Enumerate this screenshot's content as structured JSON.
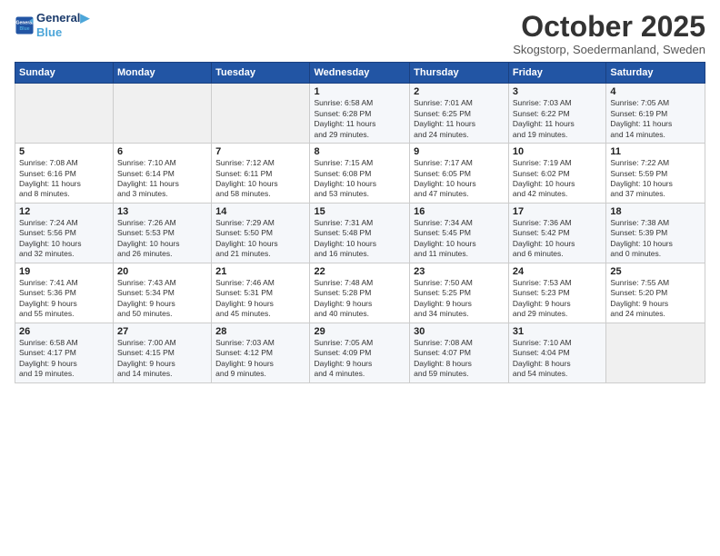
{
  "header": {
    "logo_line1": "General",
    "logo_line2": "Blue",
    "month": "October 2025",
    "location": "Skogstorp, Soedermanland, Sweden"
  },
  "weekdays": [
    "Sunday",
    "Monday",
    "Tuesday",
    "Wednesday",
    "Thursday",
    "Friday",
    "Saturday"
  ],
  "weeks": [
    [
      {
        "day": "",
        "info": ""
      },
      {
        "day": "",
        "info": ""
      },
      {
        "day": "",
        "info": ""
      },
      {
        "day": "1",
        "info": "Sunrise: 6:58 AM\nSunset: 6:28 PM\nDaylight: 11 hours\nand 29 minutes."
      },
      {
        "day": "2",
        "info": "Sunrise: 7:01 AM\nSunset: 6:25 PM\nDaylight: 11 hours\nand 24 minutes."
      },
      {
        "day": "3",
        "info": "Sunrise: 7:03 AM\nSunset: 6:22 PM\nDaylight: 11 hours\nand 19 minutes."
      },
      {
        "day": "4",
        "info": "Sunrise: 7:05 AM\nSunset: 6:19 PM\nDaylight: 11 hours\nand 14 minutes."
      }
    ],
    [
      {
        "day": "5",
        "info": "Sunrise: 7:08 AM\nSunset: 6:16 PM\nDaylight: 11 hours\nand 8 minutes."
      },
      {
        "day": "6",
        "info": "Sunrise: 7:10 AM\nSunset: 6:14 PM\nDaylight: 11 hours\nand 3 minutes."
      },
      {
        "day": "7",
        "info": "Sunrise: 7:12 AM\nSunset: 6:11 PM\nDaylight: 10 hours\nand 58 minutes."
      },
      {
        "day": "8",
        "info": "Sunrise: 7:15 AM\nSunset: 6:08 PM\nDaylight: 10 hours\nand 53 minutes."
      },
      {
        "day": "9",
        "info": "Sunrise: 7:17 AM\nSunset: 6:05 PM\nDaylight: 10 hours\nand 47 minutes."
      },
      {
        "day": "10",
        "info": "Sunrise: 7:19 AM\nSunset: 6:02 PM\nDaylight: 10 hours\nand 42 minutes."
      },
      {
        "day": "11",
        "info": "Sunrise: 7:22 AM\nSunset: 5:59 PM\nDaylight: 10 hours\nand 37 minutes."
      }
    ],
    [
      {
        "day": "12",
        "info": "Sunrise: 7:24 AM\nSunset: 5:56 PM\nDaylight: 10 hours\nand 32 minutes."
      },
      {
        "day": "13",
        "info": "Sunrise: 7:26 AM\nSunset: 5:53 PM\nDaylight: 10 hours\nand 26 minutes."
      },
      {
        "day": "14",
        "info": "Sunrise: 7:29 AM\nSunset: 5:50 PM\nDaylight: 10 hours\nand 21 minutes."
      },
      {
        "day": "15",
        "info": "Sunrise: 7:31 AM\nSunset: 5:48 PM\nDaylight: 10 hours\nand 16 minutes."
      },
      {
        "day": "16",
        "info": "Sunrise: 7:34 AM\nSunset: 5:45 PM\nDaylight: 10 hours\nand 11 minutes."
      },
      {
        "day": "17",
        "info": "Sunrise: 7:36 AM\nSunset: 5:42 PM\nDaylight: 10 hours\nand 6 minutes."
      },
      {
        "day": "18",
        "info": "Sunrise: 7:38 AM\nSunset: 5:39 PM\nDaylight: 10 hours\nand 0 minutes."
      }
    ],
    [
      {
        "day": "19",
        "info": "Sunrise: 7:41 AM\nSunset: 5:36 PM\nDaylight: 9 hours\nand 55 minutes."
      },
      {
        "day": "20",
        "info": "Sunrise: 7:43 AM\nSunset: 5:34 PM\nDaylight: 9 hours\nand 50 minutes."
      },
      {
        "day": "21",
        "info": "Sunrise: 7:46 AM\nSunset: 5:31 PM\nDaylight: 9 hours\nand 45 minutes."
      },
      {
        "day": "22",
        "info": "Sunrise: 7:48 AM\nSunset: 5:28 PM\nDaylight: 9 hours\nand 40 minutes."
      },
      {
        "day": "23",
        "info": "Sunrise: 7:50 AM\nSunset: 5:25 PM\nDaylight: 9 hours\nand 34 minutes."
      },
      {
        "day": "24",
        "info": "Sunrise: 7:53 AM\nSunset: 5:23 PM\nDaylight: 9 hours\nand 29 minutes."
      },
      {
        "day": "25",
        "info": "Sunrise: 7:55 AM\nSunset: 5:20 PM\nDaylight: 9 hours\nand 24 minutes."
      }
    ],
    [
      {
        "day": "26",
        "info": "Sunrise: 6:58 AM\nSunset: 4:17 PM\nDaylight: 9 hours\nand 19 minutes."
      },
      {
        "day": "27",
        "info": "Sunrise: 7:00 AM\nSunset: 4:15 PM\nDaylight: 9 hours\nand 14 minutes."
      },
      {
        "day": "28",
        "info": "Sunrise: 7:03 AM\nSunset: 4:12 PM\nDaylight: 9 hours\nand 9 minutes."
      },
      {
        "day": "29",
        "info": "Sunrise: 7:05 AM\nSunset: 4:09 PM\nDaylight: 9 hours\nand 4 minutes."
      },
      {
        "day": "30",
        "info": "Sunrise: 7:08 AM\nSunset: 4:07 PM\nDaylight: 8 hours\nand 59 minutes."
      },
      {
        "day": "31",
        "info": "Sunrise: 7:10 AM\nSunset: 4:04 PM\nDaylight: 8 hours\nand 54 minutes."
      },
      {
        "day": "",
        "info": ""
      }
    ]
  ]
}
